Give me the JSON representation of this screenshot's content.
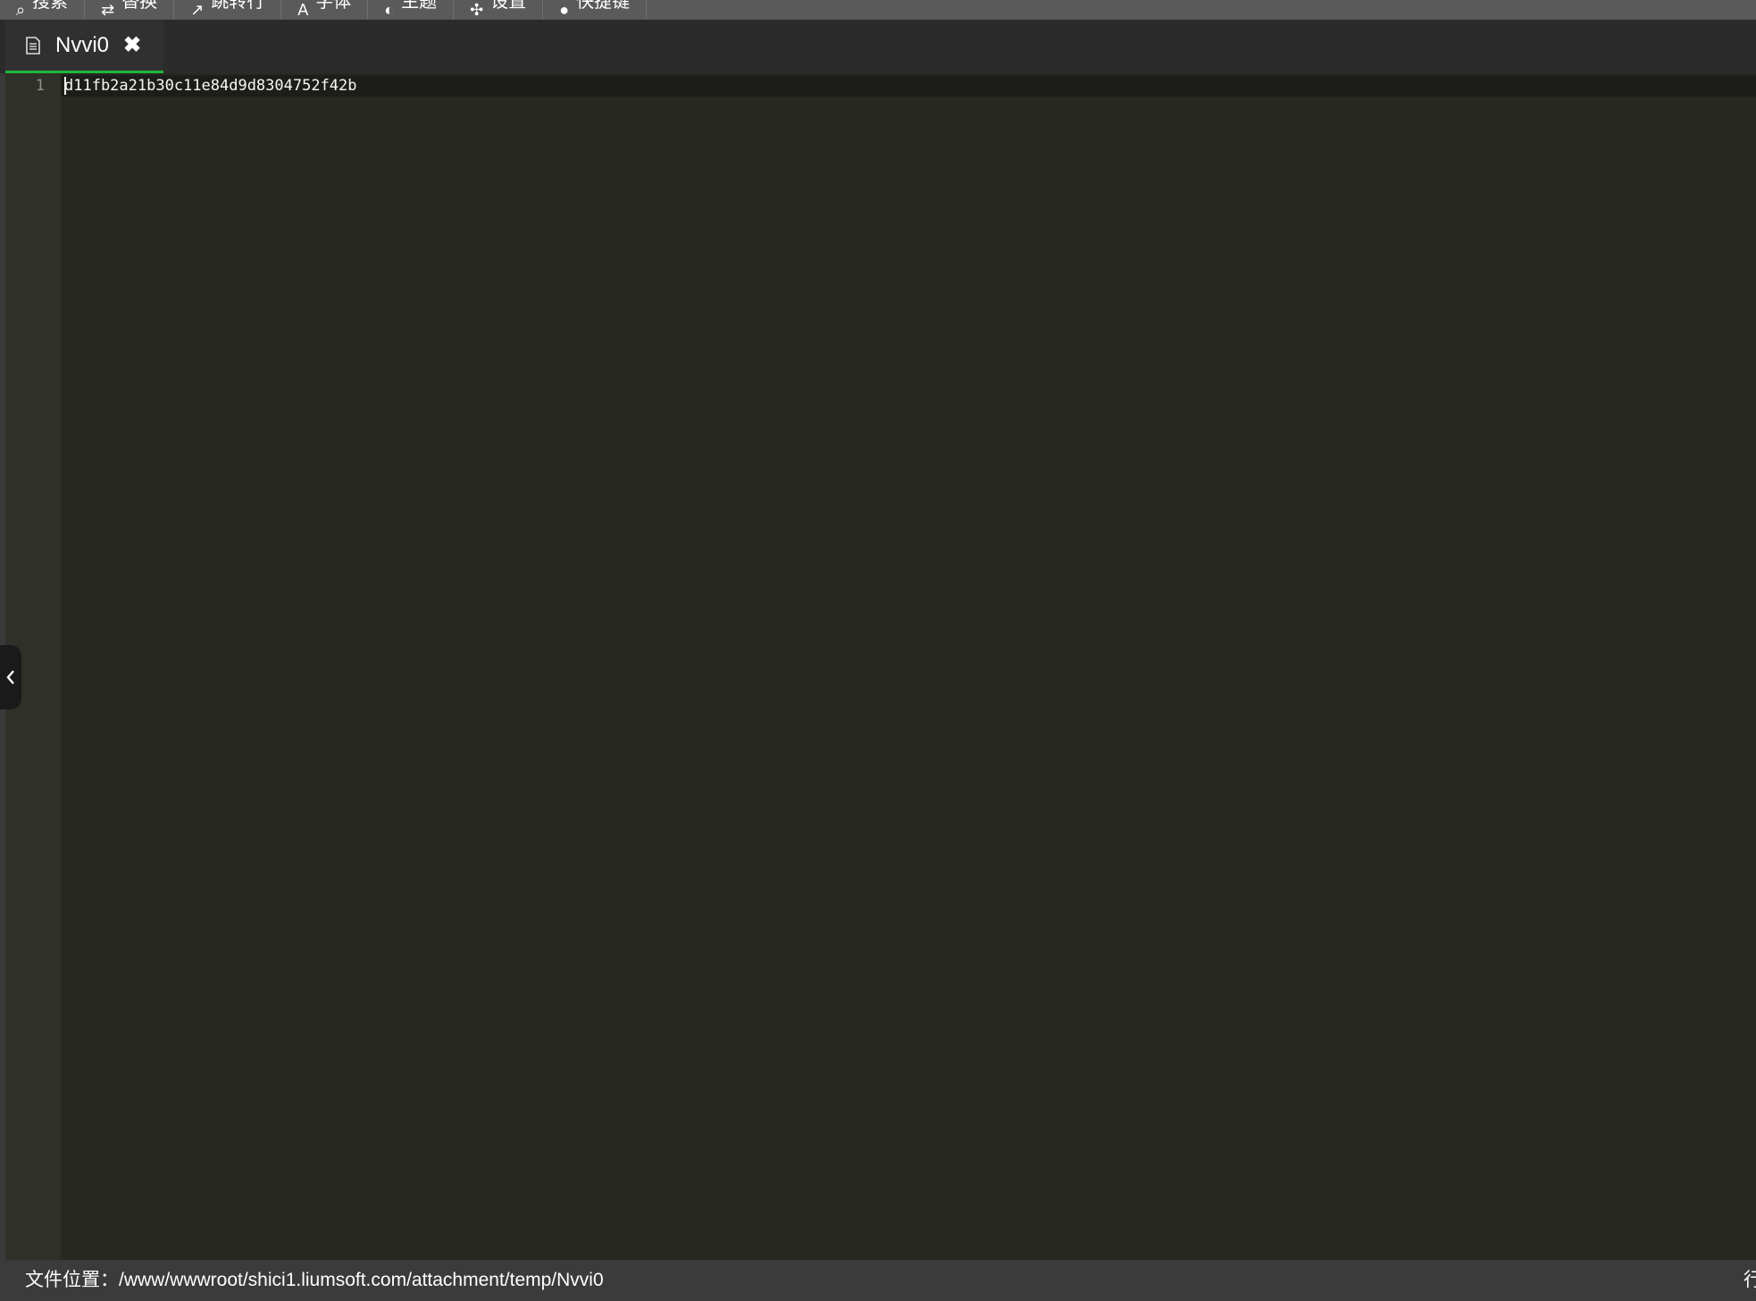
{
  "toolbar": {
    "items": [
      {
        "label": "搜索",
        "icon": "search-icon"
      },
      {
        "label": "替换",
        "icon": "replace-icon"
      },
      {
        "label": "跳转行",
        "icon": "jump-icon"
      },
      {
        "label": "字体",
        "icon": "font-icon"
      },
      {
        "label": "主题",
        "icon": "theme-icon"
      },
      {
        "label": "设置",
        "icon": "settings-icon"
      },
      {
        "label": "快捷键",
        "icon": "keyboard-icon"
      }
    ]
  },
  "tabs": [
    {
      "label": "Nvvi0",
      "icon": "file-icon",
      "active": true
    }
  ],
  "editor": {
    "lines": [
      {
        "number": "1",
        "text": "d11fb2a21b30c11e84d9d8304752f42b"
      }
    ]
  },
  "statusbar": {
    "path_label": "文件位置：/www/wwwroot/shici1.liumsoft.com/attachment/temp/Nvvi0",
    "right_text": "行"
  },
  "colors": {
    "editor_bg": "#272822",
    "gutter_bg": "#2f3129",
    "active_tab_underline": "#1fb83a",
    "toolbar_bg": "#5a5a5a",
    "statusbar_bg": "#3b3b3b"
  }
}
